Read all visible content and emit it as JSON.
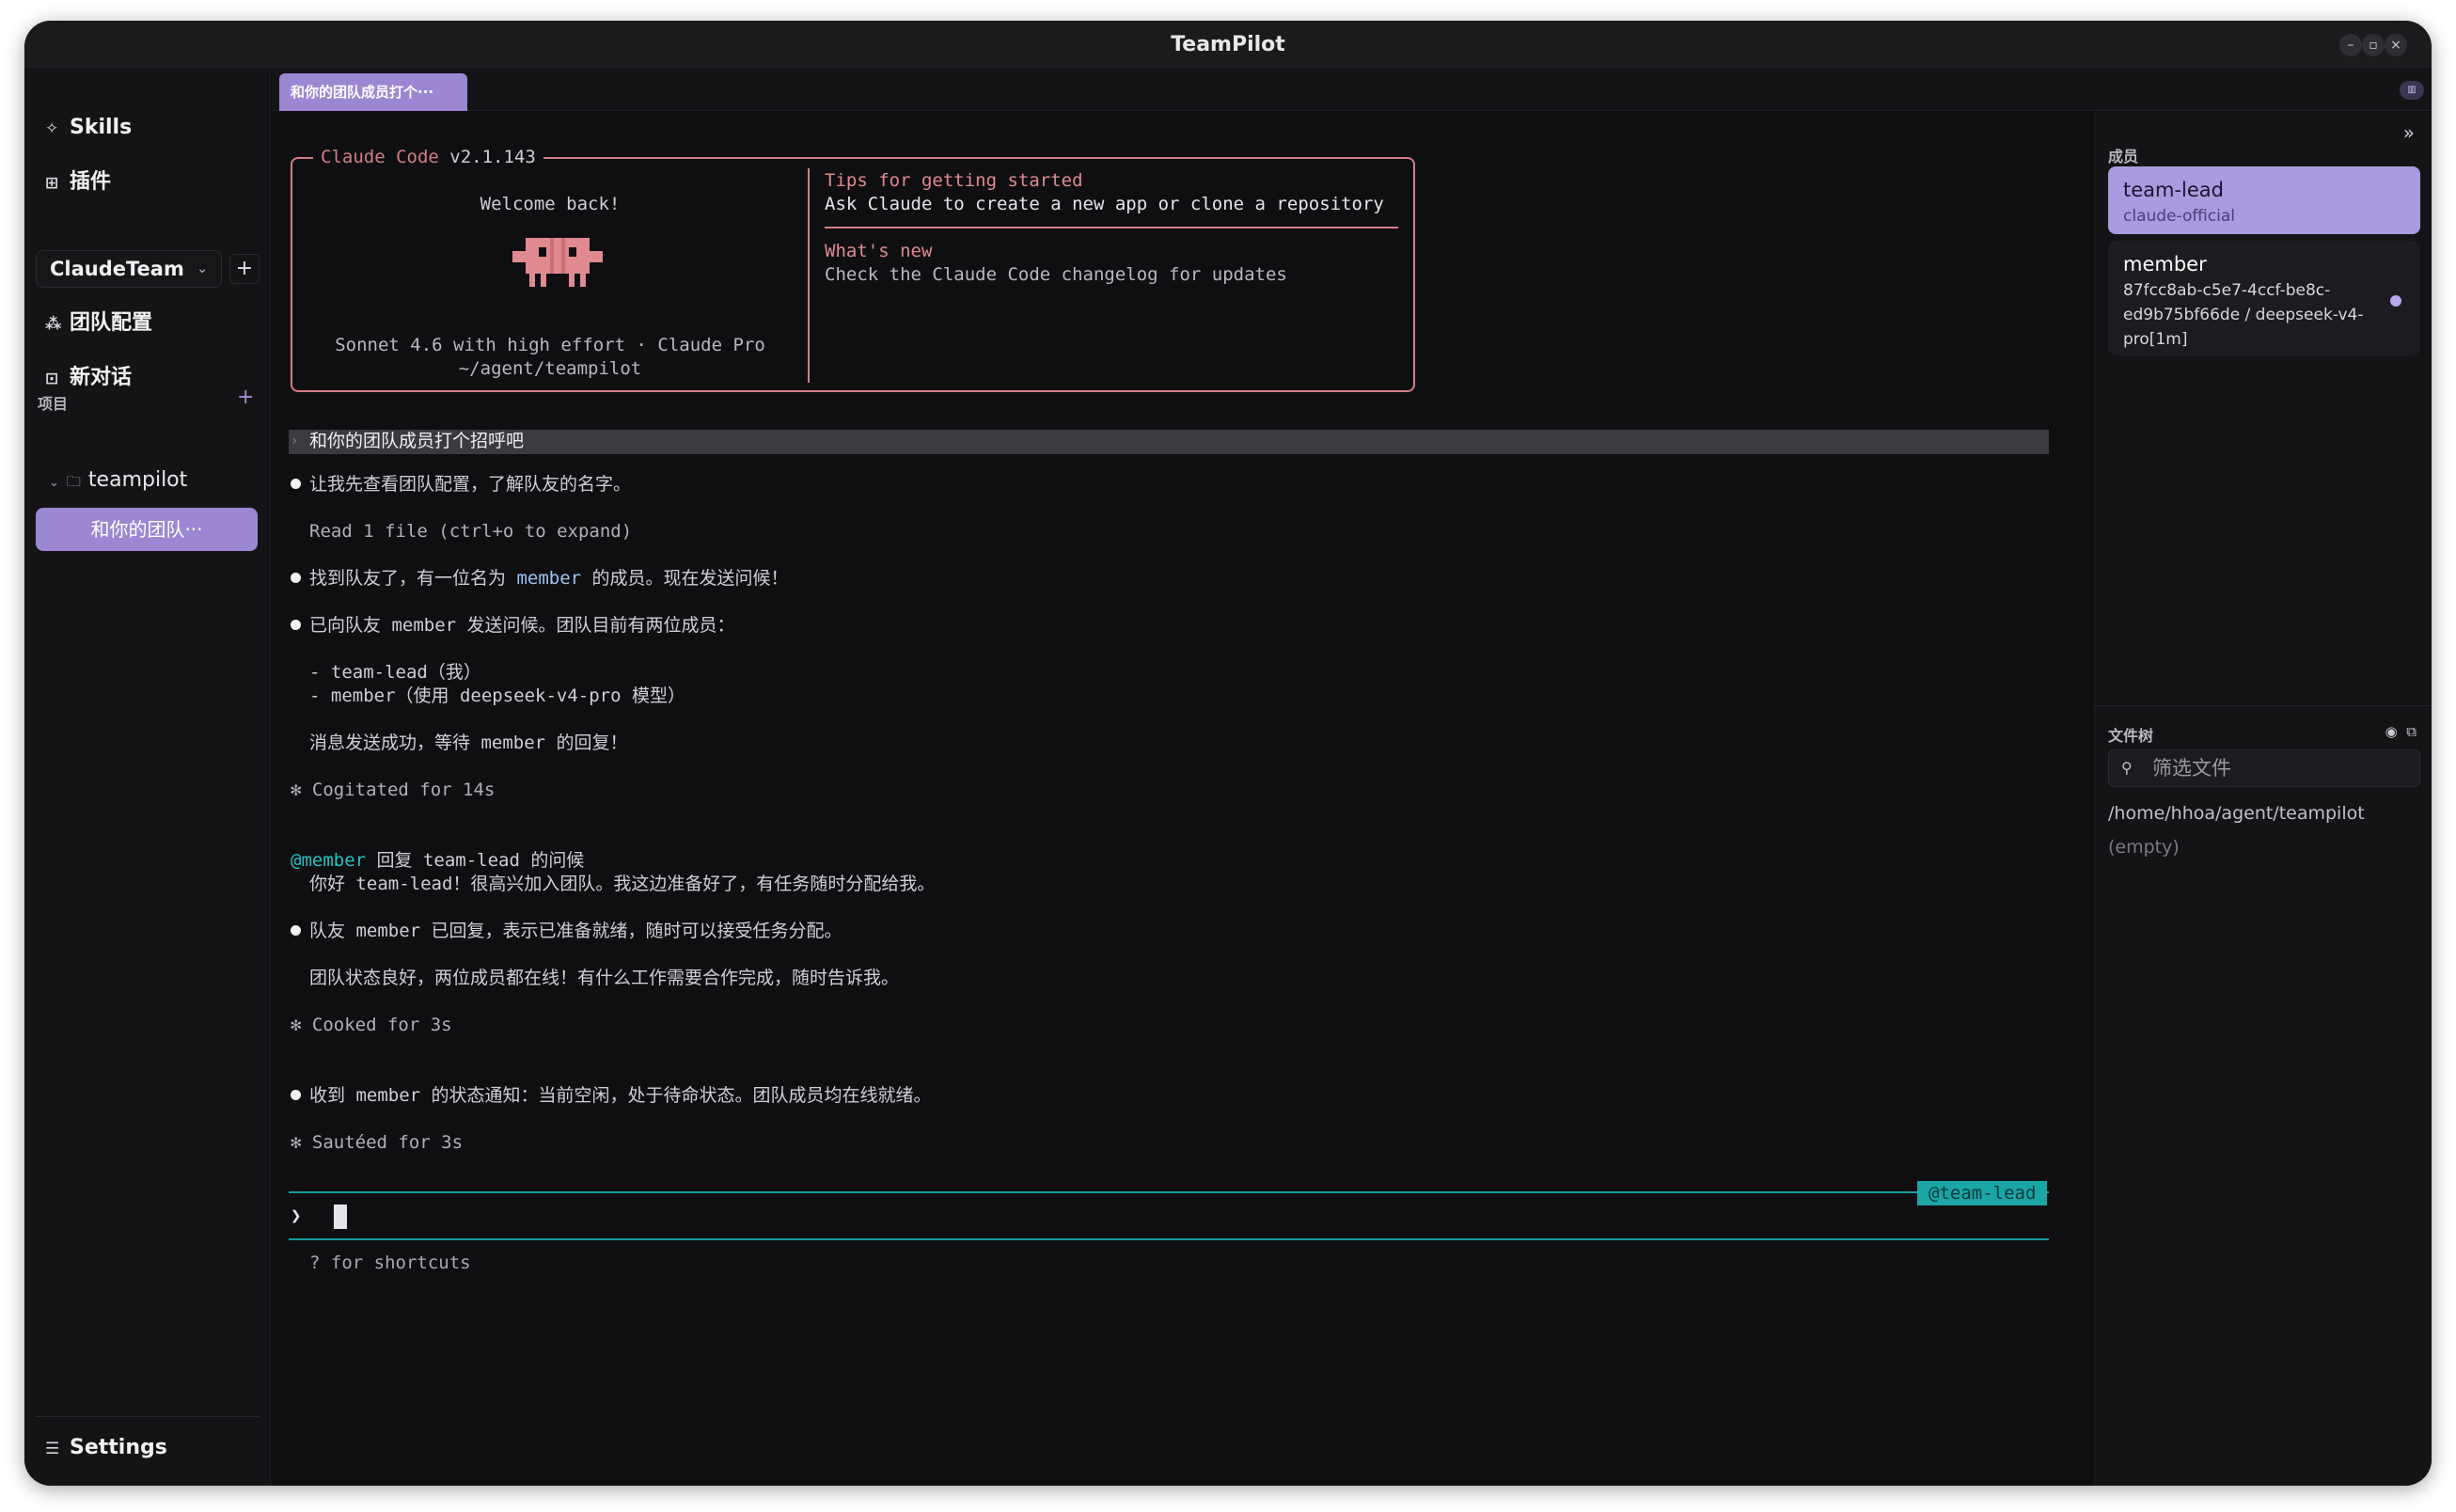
{
  "window": {
    "title": "TeamPilot",
    "btn_min": "–",
    "btn_max": "▫",
    "btn_close": "×"
  },
  "sidebar": {
    "skills": "Skills",
    "plugins": "插件",
    "team_select": "ClaudeTeam",
    "add_team": "+",
    "team_config": "团队配置",
    "new_chat": "新对话",
    "projects_label": "项目",
    "projects_add": "+",
    "project_name": "teampilot",
    "session_item": "和你的团队···",
    "settings": "Settings"
  },
  "tabs": {
    "active": "和你的团队成员打个···"
  },
  "terminal": {
    "box_title_app": "Claude Code",
    "box_title_version": "v2.1.143",
    "welcome": "Welcome back!",
    "model_line": "Sonnet 4.6 with high effort · Claude Pro",
    "cwd": "~/agent/teampilot",
    "tips_title": "Tips for getting started",
    "tips_body": "Ask Claude to create a new app or clone a repository",
    "whats_new_title": "What's new",
    "whats_new_body": "Check the Claude Code changelog for updates",
    "prompt_text": "和你的团队成员打个招呼吧",
    "msg1": "让我先查看团队配置，了解队友的名字。",
    "msg1_sub": "Read 1 file (ctrl+o to expand)",
    "msg2_a": "找到队友了，有一位名为 ",
    "msg2_member": "member",
    "msg2_b": " 的成员。现在发送问候！",
    "msg3": "已向队友 member 发送问候。团队目前有两位成员：",
    "msg3_item1": "- team-lead（我）",
    "msg3_item2": "- member（使用 deepseek-v4-pro 模型）",
    "msg3_foot": "消息发送成功，等待 member 的回复！",
    "status1": "✻ Cogitated for 14s",
    "reply_from": "@member",
    "reply_head": " 回复 team-lead 的问候",
    "reply_body": "你好 team-lead！很高兴加入团队。我这边准备好了，有任务随时分配给我。",
    "msg4": "队友 member 已回复，表示已准备就绪，随时可以接受任务分配。",
    "msg4_sub": "团队状态良好，两位成员都在线！有什么工作需要合作完成，随时告诉我。",
    "status2": "✻ Cooked for 3s",
    "msg5": "收到 member 的状态通知：当前空闲，处于待命状态。团队成员均在线就绪。",
    "status3": "✻ Sautéed for 3s",
    "agent_badge": "@team-lead",
    "input_prompt": "❯",
    "hint": "? for shortcuts"
  },
  "rightpanel": {
    "members_label": "成员",
    "collapse": "»",
    "members": [
      {
        "name": "team-lead",
        "sub": "claude-official"
      },
      {
        "name": "member",
        "sub": "87fcc8ab-c5e7-4ccf-be8c-ed9b75bf66de / deepseek-v4-pro[1m]"
      }
    ],
    "files_label": "文件树",
    "filter_placeholder": "筛选文件",
    "path": "/home/hhoa/agent/teampilot",
    "empty": "(empty)"
  },
  "colors": {
    "accent": "#9b87d2",
    "claude": "#d47d84",
    "cyan": "#20c3c3"
  }
}
